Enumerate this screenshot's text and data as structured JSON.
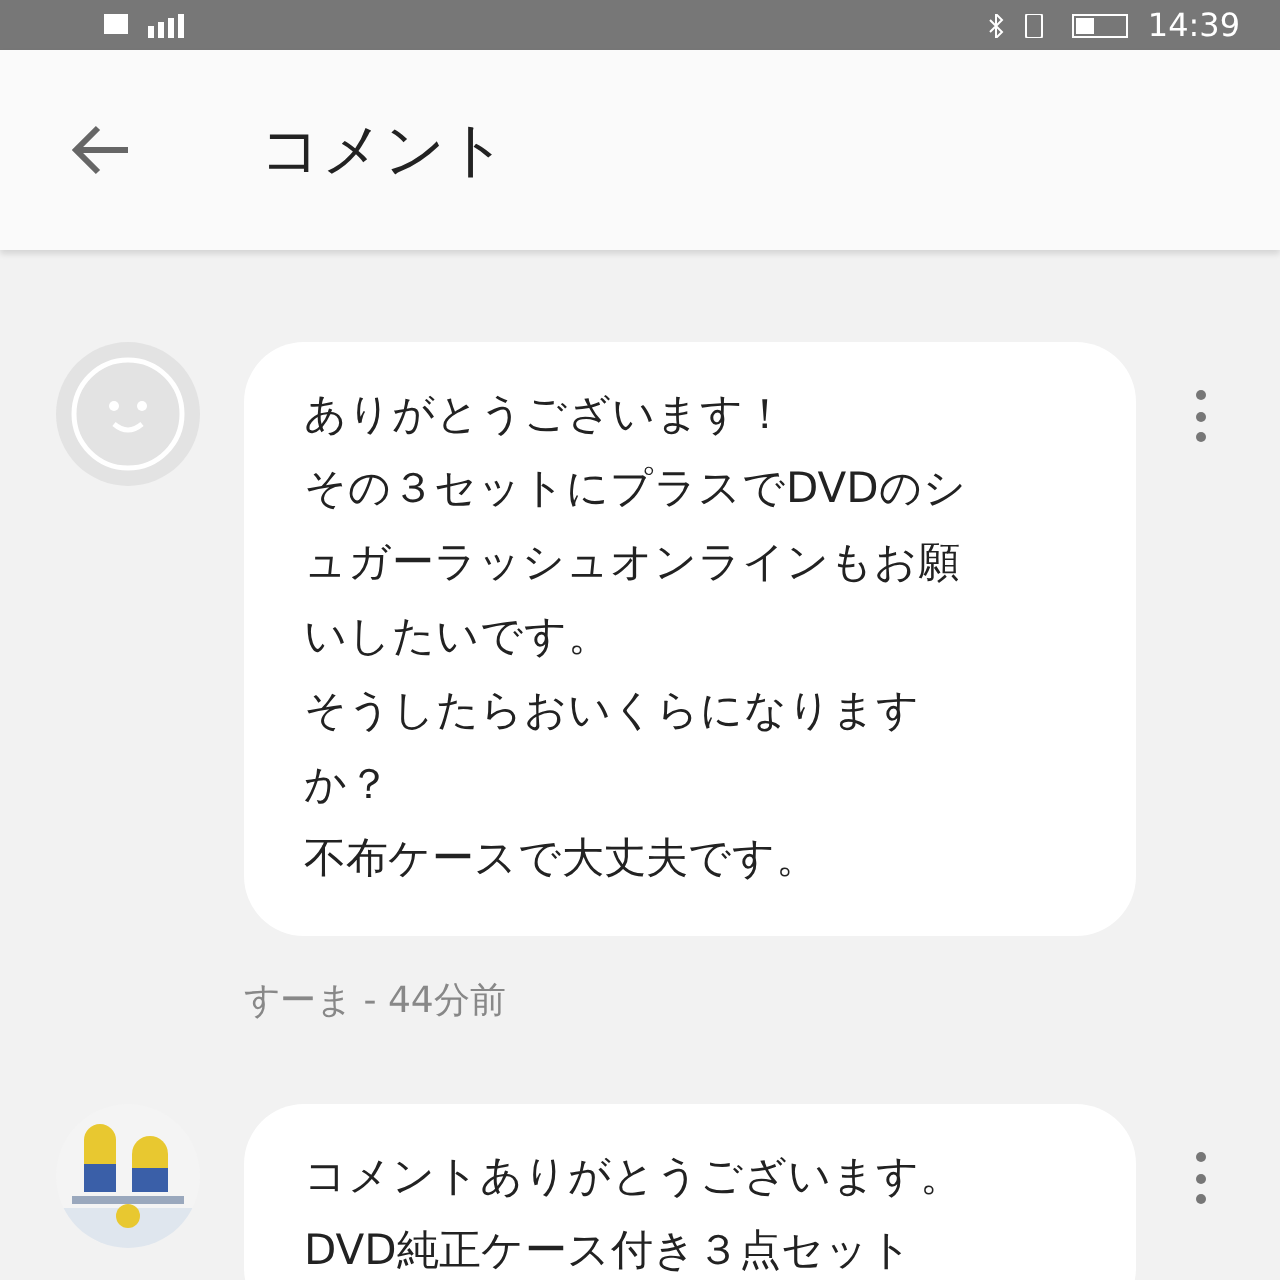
{
  "status_bar": {
    "time": "14:39"
  },
  "header": {
    "title": "コメント"
  },
  "comments": [
    {
      "kind": "default",
      "lines": [
        "ありがとうございます！",
        "その３セットにプラスでDVDのシ",
        "ュガーラッシュオンラインもお願",
        "いしたいです。",
        "そうしたらおいくらになります",
        "か？",
        "不布ケースで大丈夫です。"
      ],
      "meta": "すーま - 44分前"
    },
    {
      "kind": "picture",
      "lines": [
        "コメントありがとうございます。",
        "DVD純正ケース付き３点セット"
      ]
    }
  ]
}
